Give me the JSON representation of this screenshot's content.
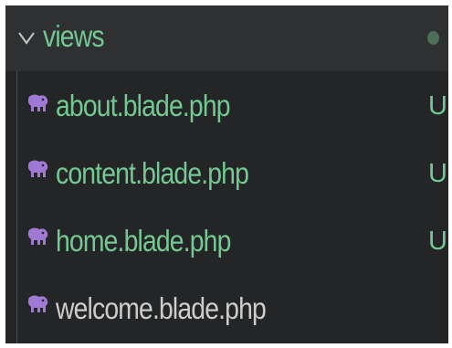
{
  "explorer": {
    "folder": {
      "label": "views",
      "chevron_icon": "chevron-down-icon",
      "status_dot_color": "#4e6e57",
      "label_color": "#73c991"
    },
    "files": [
      {
        "label": "about.blade.php",
        "badge": "U",
        "icon": "laravel-blade-elephant-icon",
        "label_color": "#73c991"
      },
      {
        "label": "content.blade.php",
        "badge": "U",
        "icon": "laravel-blade-elephant-icon",
        "label_color": "#73c991"
      },
      {
        "label": "home.blade.php",
        "badge": "U",
        "icon": "laravel-blade-elephant-icon",
        "label_color": "#73c991"
      },
      {
        "label": "welcome.blade.php",
        "badge": "",
        "icon": "laravel-blade-elephant-icon",
        "label_color": "#cccccc"
      }
    ],
    "colors": {
      "background": "#242526",
      "folder_row_background": "#2e3031",
      "untracked_green": "#73c991",
      "icon_purple": "#a179d4",
      "default_text": "#cccccc"
    }
  }
}
